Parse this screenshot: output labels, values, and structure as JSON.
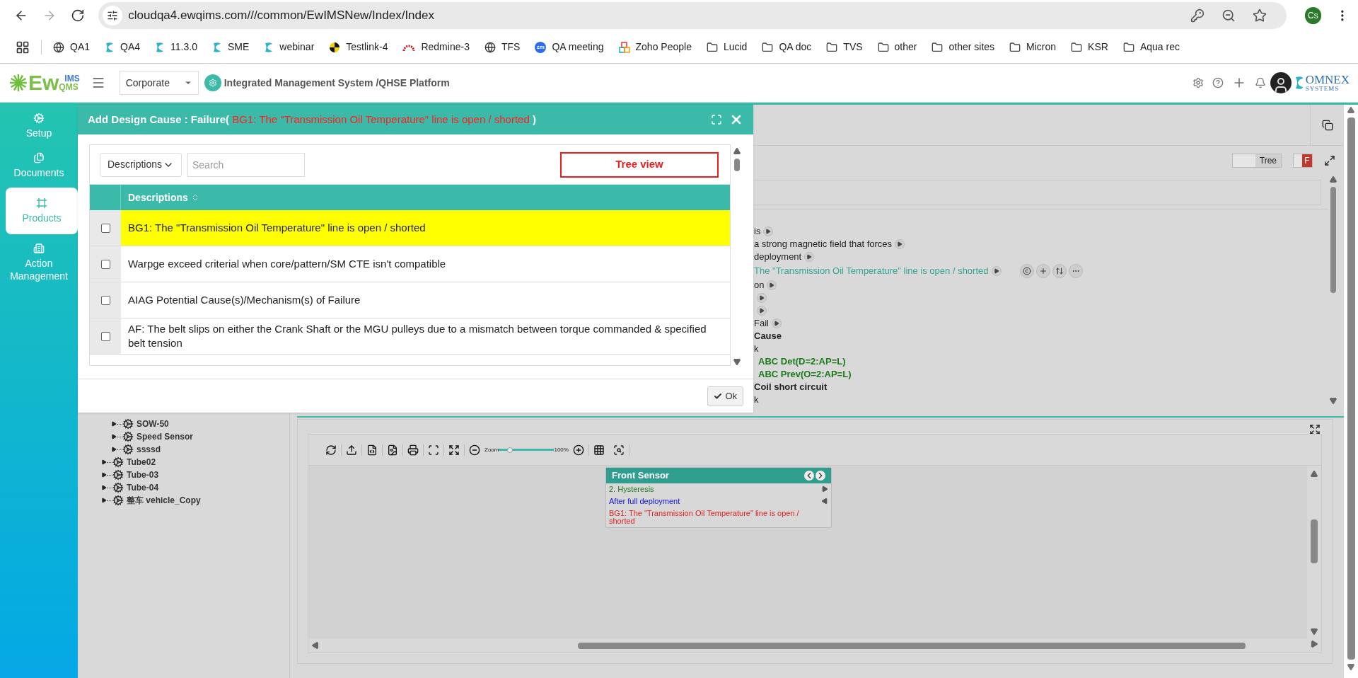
{
  "browser": {
    "url": "cloudqa4.ewqims.com///common/EwIMSNew/Index/Index",
    "profile": "Cs",
    "forward_disabled": true
  },
  "bookmarks": [
    {
      "kind": "globe",
      "label": "QA1"
    },
    {
      "kind": "ew",
      "label": "QA4"
    },
    {
      "kind": "ew",
      "label": "11.3.0"
    },
    {
      "kind": "ew",
      "label": "SME"
    },
    {
      "kind": "ew",
      "label": "webinar"
    },
    {
      "kind": "testlink",
      "label": "Testlink-4"
    },
    {
      "kind": "redmine",
      "label": "Redmine-3"
    },
    {
      "kind": "globe",
      "label": "TFS"
    },
    {
      "kind": "zoom",
      "label": "QA meeting",
      "badge": "zm"
    },
    {
      "kind": "zoho",
      "label": "Zoho People"
    },
    {
      "kind": "folder",
      "label": "Lucid"
    },
    {
      "kind": "folder",
      "label": "QA doc"
    },
    {
      "kind": "folder",
      "label": "TVS"
    },
    {
      "kind": "folder",
      "label": "other"
    },
    {
      "kind": "folder",
      "label": "other sites"
    },
    {
      "kind": "folder",
      "label": "Micron"
    },
    {
      "kind": "folder",
      "label": "KSR"
    },
    {
      "kind": "folder",
      "label": "Aqua rec"
    }
  ],
  "header": {
    "logo_main": "Ew",
    "logo_top": "IMS",
    "logo_bottom": "QMS",
    "site": "Corporate",
    "title": "Integrated Management System /QHSE Platform",
    "brand": "OMNEX",
    "brand_sub": "SYSTEMS"
  },
  "sidebar": {
    "items": [
      {
        "kind": "setup",
        "label": "Setup",
        "selected": false
      },
      {
        "kind": "documents",
        "label": "Documents",
        "selected": false
      },
      {
        "kind": "products",
        "label": "Products",
        "selected": true
      },
      {
        "kind": "actions",
        "label": "Action Management",
        "selected": false
      }
    ]
  },
  "tree": {
    "items": [
      {
        "children": [
          {
            "label": "SOW-50"
          },
          {
            "label": "Speed Sensor"
          },
          {
            "label": "ssssd"
          }
        ]
      },
      {
        "label": "Tube02"
      },
      {
        "label": "Tube-03"
      },
      {
        "label": "Tube-04"
      },
      {
        "label": "整车 vehicle_Copy"
      }
    ]
  },
  "mindmap": {
    "view_toggle": "Tree",
    "flag": "F",
    "rows": [
      {
        "kind": "node",
        "text": "is"
      },
      {
        "kind": "node",
        "text": "a strong magnetic field that forces"
      },
      {
        "kind": "node",
        "text": "deployment"
      },
      {
        "kind": "active",
        "text": "The \"Transmission Oil Temperature\" line is open / shorted"
      },
      {
        "kind": "node",
        "text": "on"
      },
      {
        "kind": "stub"
      },
      {
        "kind": "stub"
      },
      {
        "kind": "node",
        "text": "Fail"
      },
      {
        "kind": "heading",
        "text": "Cause"
      },
      {
        "kind": "leaf",
        "text": "k"
      },
      {
        "kind": "rating",
        "text": "ABC Det(D=2:AP=L)"
      },
      {
        "kind": "rating",
        "text": "ABC Prev(O=2:AP=L)"
      },
      {
        "kind": "heading",
        "text": "Coil short circuit"
      },
      {
        "kind": "leaf",
        "text": "k"
      }
    ]
  },
  "diagram": {
    "zoom_label": "Zoom",
    "zoom_value": "100%",
    "zoom": {
      "level": 0.2
    },
    "card": {
      "title": "Front Sensor",
      "items": [
        {
          "text": "2. Hysteresis",
          "color": "#1a7a1a",
          "kind": "forward"
        },
        {
          "text": "After full deployment",
          "color": "#1010e0",
          "kind": "back"
        },
        {
          "text": "BG1: The \"Transmission Oil Temperature\" line is open / shorted",
          "color": "#e02020",
          "kind": "plain"
        }
      ]
    }
  },
  "dialog": {
    "title_prefix": "Add Design Cause : Failure(",
    "title_highlight": "BG1: The \"Transmission Oil Temperature\" line is open / shorted",
    "title_suffix": ")",
    "filter_field": "Descriptions",
    "search_placeholder": "Search",
    "tree_view_button": "Tree view",
    "column": "Descriptions",
    "rows": [
      {
        "text": "BG1: The \"Transmission Oil Temperature\" line is open / shorted",
        "highlighted": true,
        "checked": false
      },
      {
        "text": "Warpge exceed criterial when core/pattern/SM CTE isn't compatible",
        "highlighted": false,
        "checked": false
      },
      {
        "text": "AIAG Potential Cause(s)/Mechanism(s) of Failure",
        "highlighted": false,
        "checked": false
      },
      {
        "text": "AF: The belt slips on either the Crank Shaft or the MGU pulleys due to a mismatch between torque commanded & specified belt tension",
        "highlighted": false,
        "checked": false
      }
    ],
    "ok_button": "Ok"
  }
}
